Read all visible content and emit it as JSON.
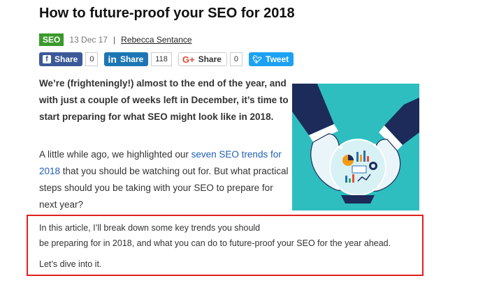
{
  "article": {
    "title": "How to future-proof your SEO for 2018",
    "tag": "SEO",
    "date": "13 Dec 17",
    "separator": "|",
    "author": "Rebecca Sentance"
  },
  "share": {
    "facebook_label": "Share",
    "facebook_count": "0",
    "linkedin_label": "Share",
    "linkedin_count": "118",
    "google_label": "Share",
    "google_count": "0",
    "twitter_label": "Tweet",
    "icons": [
      "facebook-icon",
      "linkedin-icon",
      "google-plus-icon",
      "twitter-icon"
    ]
  },
  "body": {
    "intro": "We’re (frighteningly!) almost to the end of the year, and with just a couple of weeks left in December, it’s time to start preparing for what SEO might look like in 2018.",
    "p2_before": "A little while ago, we highlighted our ",
    "p2_link": "seven SEO trends for 2018",
    "p2_after": " that you should be watching out for. But what practical steps should you be taking with your SEO to prepare for next year?",
    "p3_line1": "In this article, I’ll break down some key trends you should",
    "p3_line2": "be preparing for in 2018, and what you can do to future-proof your SEO for the year ahead.",
    "p4": "Let’s dive into it."
  },
  "colors": {
    "tag_bg": "#3a9a2a",
    "link": "#1f5fb5",
    "highlight_border": "#e02020",
    "hero_bg": "#2ebec0"
  }
}
